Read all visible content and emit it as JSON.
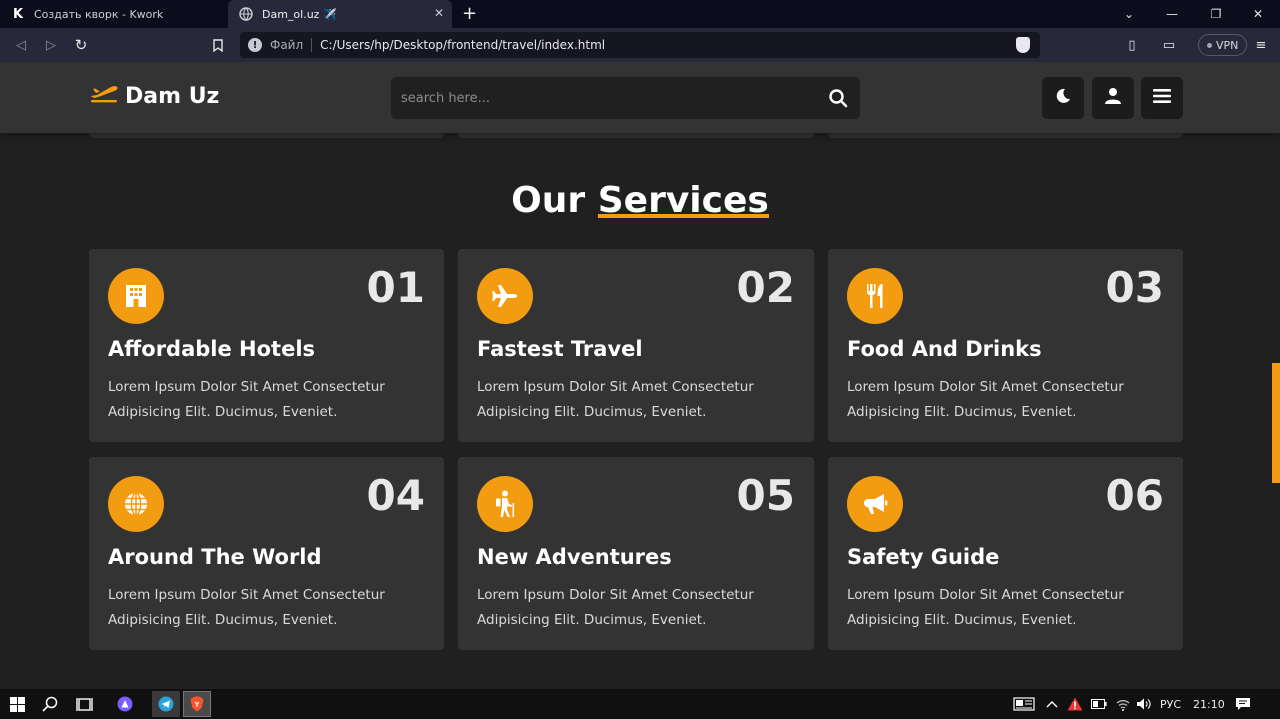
{
  "browser": {
    "tabs": [
      {
        "label": "Создать кворк - Kwork",
        "favicon": "K"
      },
      {
        "label": "Dam_ol.uz ✈️",
        "favicon": "globe"
      }
    ],
    "address": {
      "scheme_label": "Файл",
      "url": "C:/Users/hp/Desktop/frontend/travel/index.html"
    },
    "vpn_label": "VPN"
  },
  "site": {
    "logo_text": "Dam Uz",
    "search_placeholder": "search here...",
    "accent": "#f39c12"
  },
  "services": {
    "heading_plain": "Our",
    "heading_highlight": "Services",
    "cards": [
      {
        "num": "01",
        "title": "Affordable Hotels",
        "desc": "Lorem Ipsum Dolor Sit Amet Consectetur Adipisicing Elit. Ducimus, Eveniet.",
        "icon": "hotel-icon"
      },
      {
        "num": "02",
        "title": "Fastest Travel",
        "desc": "Lorem Ipsum Dolor Sit Amet Consectetur Adipisicing Elit. Ducimus, Eveniet.",
        "icon": "plane-icon"
      },
      {
        "num": "03",
        "title": "Food And Drinks",
        "desc": "Lorem Ipsum Dolor Sit Amet Consectetur Adipisicing Elit. Ducimus, Eveniet.",
        "icon": "utensils-icon"
      },
      {
        "num": "04",
        "title": "Around The World",
        "desc": "Lorem Ipsum Dolor Sit Amet Consectetur Adipisicing Elit. Ducimus, Eveniet.",
        "icon": "globe-icon"
      },
      {
        "num": "05",
        "title": "New Adventures",
        "desc": "Lorem Ipsum Dolor Sit Amet Consectetur Adipisicing Elit. Ducimus, Eveniet.",
        "icon": "hiking-icon"
      },
      {
        "num": "06",
        "title": "Safety Guide",
        "desc": "Lorem Ipsum Dolor Sit Amet Consectetur Adipisicing Elit. Ducimus, Eveniet.",
        "icon": "bullhorn-icon"
      }
    ]
  },
  "taskbar": {
    "language": "РУС",
    "time": "21:10"
  }
}
